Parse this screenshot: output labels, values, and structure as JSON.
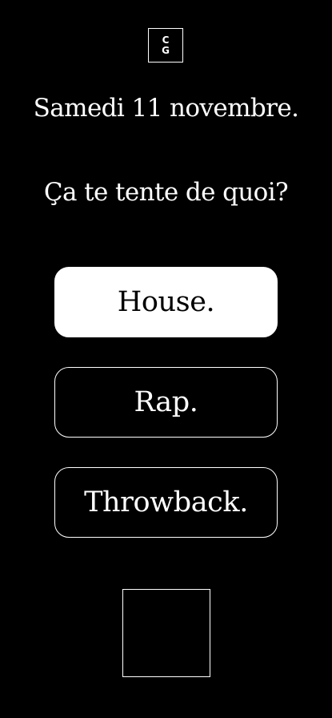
{
  "logo": {
    "line1": "C",
    "line2": "G"
  },
  "header": {
    "date": "Samedi 11 novembre.",
    "question": "Ça te tente de quoi?"
  },
  "choices": [
    {
      "label": "House.",
      "selected": true
    },
    {
      "label": "Rap.",
      "selected": false
    },
    {
      "label": "Throwback.",
      "selected": false
    }
  ],
  "colors": {
    "background": "#000000",
    "foreground": "#ffffff"
  }
}
